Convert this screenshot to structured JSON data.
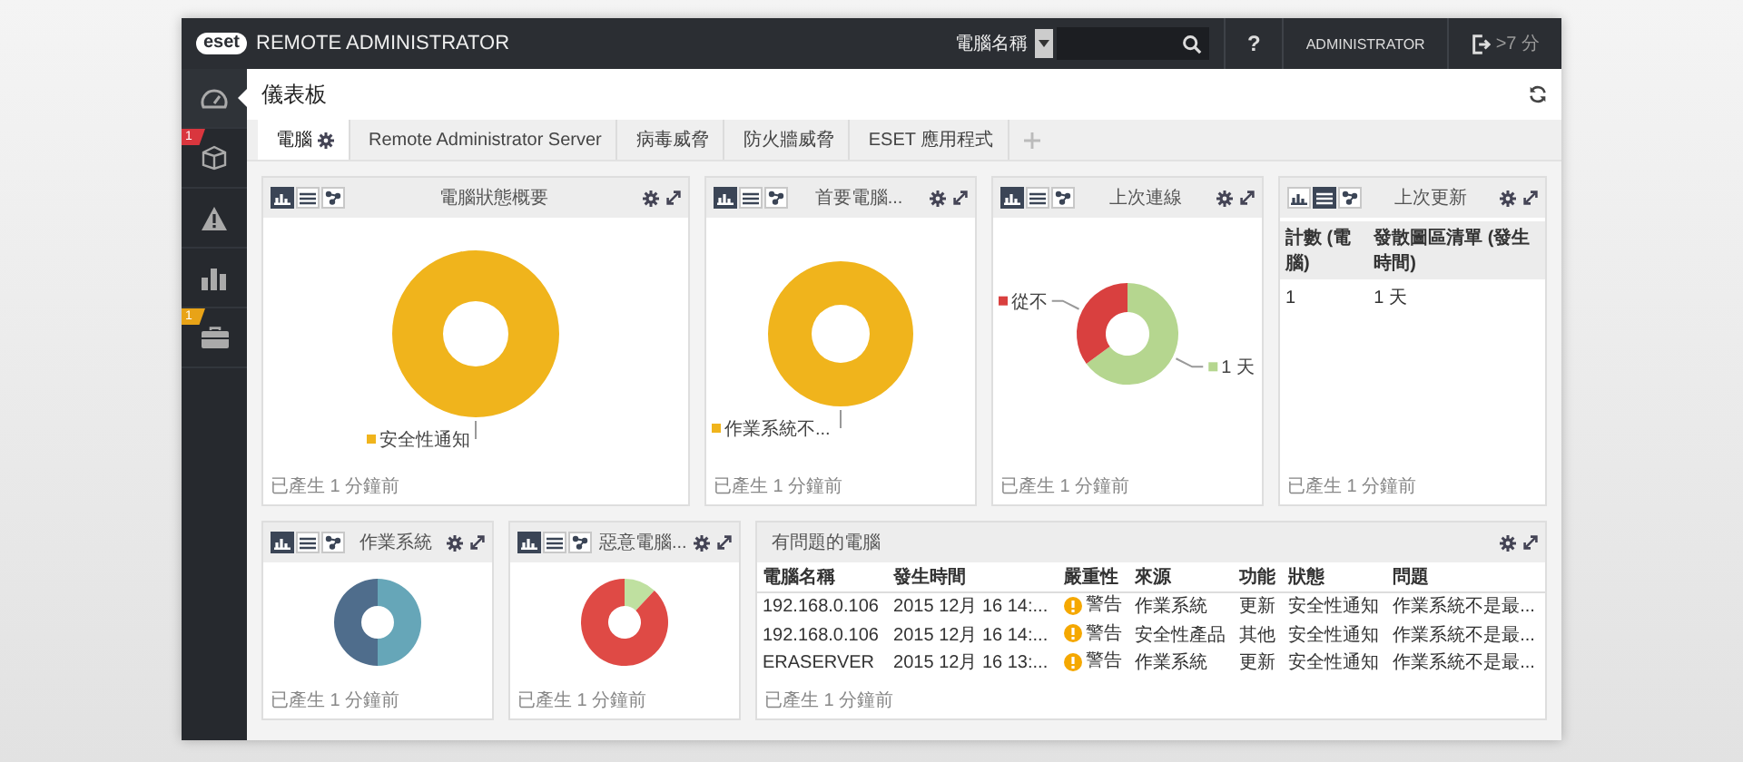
{
  "topbar": {
    "logo": "eset",
    "product": "REMOTE ADMINISTRATOR",
    "search_scope": "電腦名稱",
    "help": "?",
    "user": "ADMINISTRATOR",
    "session": ">7 分"
  },
  "sidebar": {
    "items": [
      {
        "kind": "dashboard",
        "selected": true
      },
      {
        "kind": "computers",
        "selected": false,
        "badge": {
          "text": "1",
          "color": "#d9363e"
        }
      },
      {
        "kind": "alerts",
        "selected": false
      },
      {
        "kind": "reports",
        "selected": false
      },
      {
        "kind": "tasks",
        "selected": false,
        "badge": {
          "text": "1",
          "color": "#e8a317"
        }
      }
    ]
  },
  "page": {
    "title": "儀表板"
  },
  "tabs": [
    {
      "label": "電腦",
      "selected": true
    },
    {
      "label": "Remote Administrator Server",
      "selected": false
    },
    {
      "label": "病毒威脅",
      "selected": false
    },
    {
      "label": "防火牆威脅",
      "selected": false
    },
    {
      "label": "ESET 應用程式",
      "selected": false
    }
  ],
  "widget_rows": [
    [
      {
        "kind": "chart",
        "title": "電腦狀態概要",
        "view_buttons": [
          {
            "selected": true
          },
          {
            "selected": false
          },
          {
            "selected": false
          }
        ],
        "slices": [
          {
            "label": "安全性通知",
            "color": "#f0b41c"
          }
        ],
        "footer": "已產生 1 分鐘前"
      },
      {
        "kind": "chart",
        "title": "首要電腦...",
        "view_buttons": [
          {
            "selected": true
          },
          {
            "selected": false
          },
          {
            "selected": false
          }
        ],
        "slices": [
          {
            "label": "作業系統不...",
            "color": "#f0b41c"
          }
        ],
        "footer": "已產生 1 分鐘前"
      },
      {
        "kind": "chart",
        "title": "上次連線",
        "view_buttons": [
          {
            "selected": true
          },
          {
            "selected": false
          },
          {
            "selected": false
          }
        ],
        "slices": [
          {
            "label": "1 天",
            "color": "#b5d68f"
          },
          {
            "label": "從不",
            "color": "#d9403f"
          }
        ],
        "footer": "已產生 1 分鐘前"
      },
      {
        "kind": "table",
        "title": "上次更新",
        "view_buttons": [
          {
            "selected": false
          },
          {
            "selected": true
          },
          {
            "selected": false
          }
        ],
        "columns": [
          "計數 (電腦)",
          "發散圖區清單 (發生時間)"
        ],
        "rows": [
          [
            "1",
            "1 天"
          ]
        ],
        "footer": "已產生 1 分鐘前"
      }
    ],
    [
      {
        "kind": "chart",
        "title": "作業系統",
        "view_buttons": [
          {
            "selected": true
          },
          {
            "selected": false
          },
          {
            "selected": false
          }
        ],
        "slices": [
          {
            "color": "#66a6b8"
          },
          {
            "color": "#4f6d8c"
          }
        ],
        "footer": "已產生 1 分鐘前"
      },
      {
        "kind": "chart",
        "title": "惡意電腦...",
        "view_buttons": [
          {
            "selected": true
          },
          {
            "selected": false
          },
          {
            "selected": false
          }
        ],
        "slices": [
          {
            "color": "#bfe0a0"
          },
          {
            "color": "#df4a45"
          }
        ],
        "footer": "已產生 1 分鐘前"
      },
      {
        "kind": "issues",
        "title": "有問題的電腦",
        "columns": [
          "電腦名稱",
          "發生時間",
          "嚴重性",
          "來源",
          "功能",
          "狀態",
          "問題"
        ],
        "rows": [
          {
            "computer": "192.168.0.106",
            "time": "2015 12月 16 14:...",
            "kind": "warning",
            "severity": "警告",
            "source": "作業系統",
            "feature": "更新",
            "status": "安全性通知",
            "issue": "作業系統不是最..."
          },
          {
            "computer": "192.168.0.106",
            "time": "2015 12月 16 14:...",
            "kind": "warning",
            "severity": "警告",
            "source": "安全性產品",
            "feature": "其他",
            "status": "安全性通知",
            "issue": "作業系統不是最..."
          },
          {
            "computer": "ERASERVER",
            "time": "2015 12月 16 13:...",
            "kind": "warning",
            "severity": "警告",
            "source": "作業系統",
            "feature": "更新",
            "status": "安全性通知",
            "issue": "作業系統不是最..."
          }
        ],
        "footer": "已產生 1 分鐘前"
      }
    ]
  ]
}
